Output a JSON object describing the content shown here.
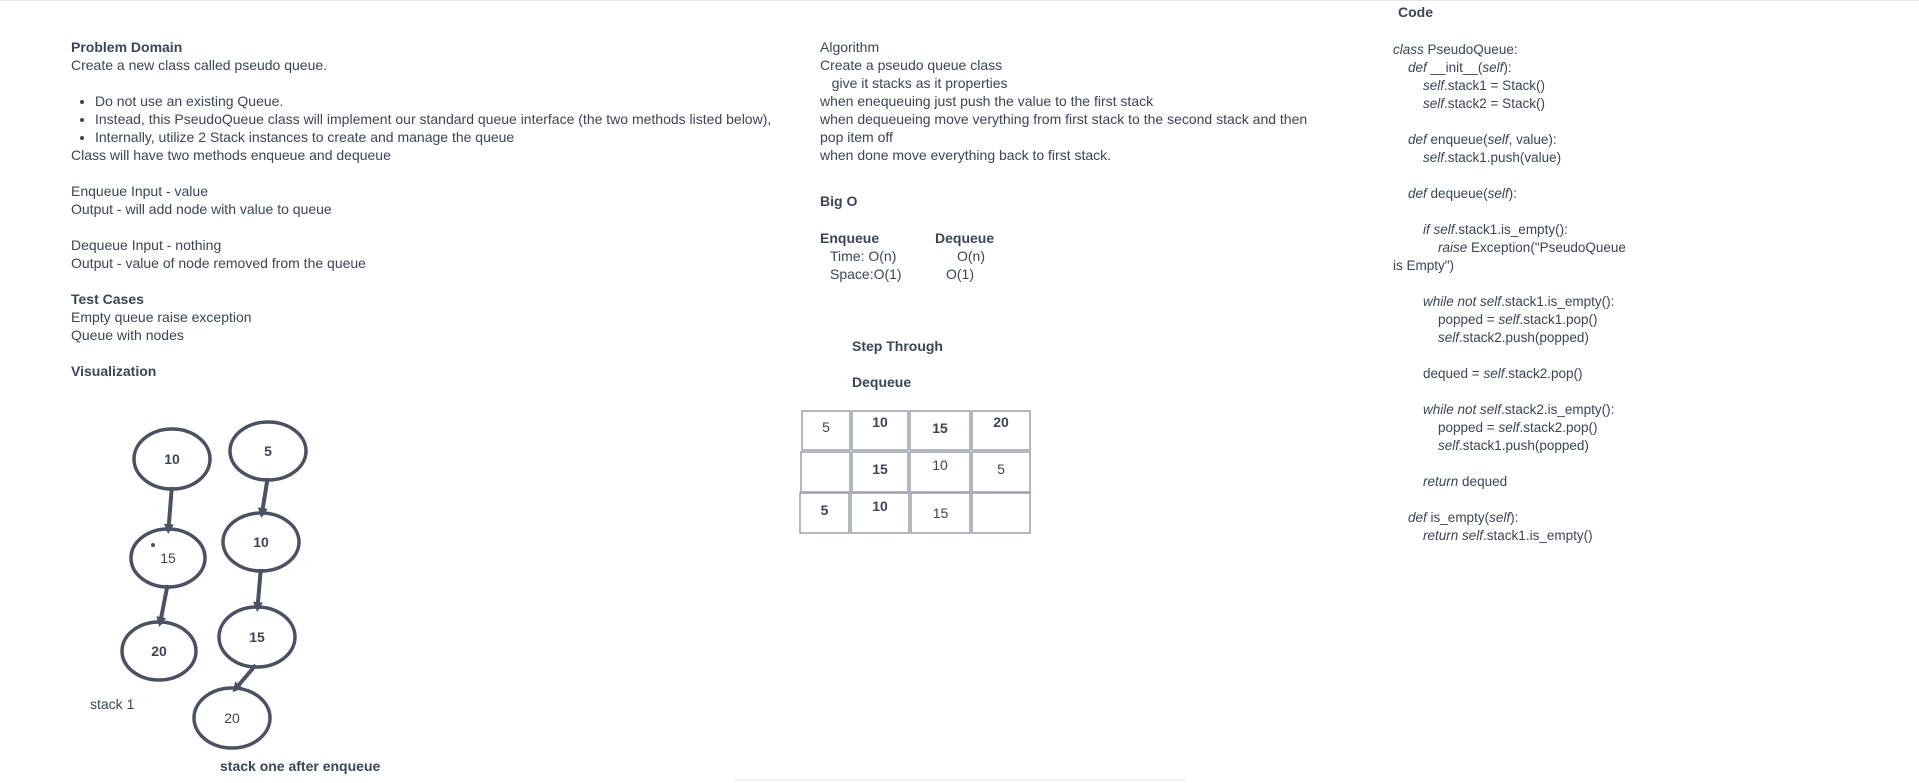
{
  "problem": {
    "heading": "Problem Domain",
    "intro": "Create a new class called pseudo queue.",
    "bullets": [
      "Do not use an existing Queue.",
      "Instead, this PseudoQueue class will implement our standard queue interface (the two methods listed below),",
      "Internally, utilize 2 Stack instances to create and manage the queue"
    ],
    "methods": "Class will have two methods enqueue and dequeue",
    "enqueue_input": "Enqueue Input - value",
    "enqueue_output": "Output - will add node with value to queue",
    "dequeue_input": "Dequeue Input - nothing",
    "dequeue_output": "Output - value of node removed from the queue",
    "tests_heading": "Test Cases",
    "tests": [
      "Empty queue raise exception",
      "Queue with nodes"
    ],
    "viz_heading": "Visualization"
  },
  "visualization": {
    "stack1_nodes": [
      "10",
      "15",
      "20"
    ],
    "stack1_bold": [
      true,
      false,
      true
    ],
    "stack1_label": "stack 1",
    "stack2_nodes": [
      "5",
      "10",
      "15",
      "20"
    ],
    "stack2_bold": [
      true,
      true,
      true,
      false
    ],
    "stack2_label": "stack one after enqueue",
    "stroke_color": "#4a5261"
  },
  "algorithm": {
    "lines": [
      "Algorithm",
      "Create a pseudo queue class",
      "   give it stacks as it properties",
      "when enequeuing just push the value to the first stack",
      "when dequeueing move verything from first stack to the second stack and then",
      "pop item off",
      "when done move everything back to first stack."
    ]
  },
  "bigo": {
    "heading": "Big O",
    "enqueue_label": "Enqueue",
    "dequeue_label": "Dequeue",
    "enqueue_time": "Time: O(n)",
    "enqueue_space": "Space:O(1)",
    "dequeue_time": "O(n)",
    "dequeue_space": "O(1)"
  },
  "step_through": {
    "heading": "Step Through",
    "subheading": "Dequeue",
    "rows": [
      [
        "5",
        "10",
        "15",
        "20"
      ],
      [
        "",
        "15",
        "10",
        "5"
      ],
      [
        "5",
        "10",
        "15",
        ""
      ]
    ],
    "bold": [
      [
        false,
        true,
        true,
        true
      ],
      [
        false,
        true,
        false,
        false
      ],
      [
        true,
        true,
        false,
        false
      ]
    ]
  },
  "code": {
    "heading": "Code",
    "lines": [
      "",
      "<i>class</i> PseudoQueue:",
      "    <i>def</i> __init__(<i>self</i>):",
      "        <i>self</i>.stack1 = Stack()",
      "        <i>self</i>.stack2 = Stack()",
      "",
      "    <i>def</i> enqueue(<i>self</i>, value):",
      "        <i>self</i>.stack1.push(value)",
      "",
      "    <i>def</i> dequeue(<i>self</i>):",
      "",
      "        <i>if self</i>.stack1.is_empty():",
      "            <i>raise</i> Exception(\"PseudoQueue",
      "is Empty\")",
      "",
      "        <i>while not self</i>.stack1.is_empty():",
      "            popped = <i>self</i>.stack1.pop()",
      "            <i>self</i>.stack2.push(popped)",
      "",
      "        dequed = <i>self</i>.stack2.pop()",
      "",
      "        <i>while not self</i>.stack2.is_empty():",
      "            popped = <i>self</i>.stack2.pop()",
      "            <i>self</i>.stack1.push(popped)",
      "",
      "        <i>return</i> dequed",
      "",
      "    <i>def</i> is_empty(<i>self</i>):",
      "        <i>return self</i>.stack1.is_empty()"
    ]
  }
}
